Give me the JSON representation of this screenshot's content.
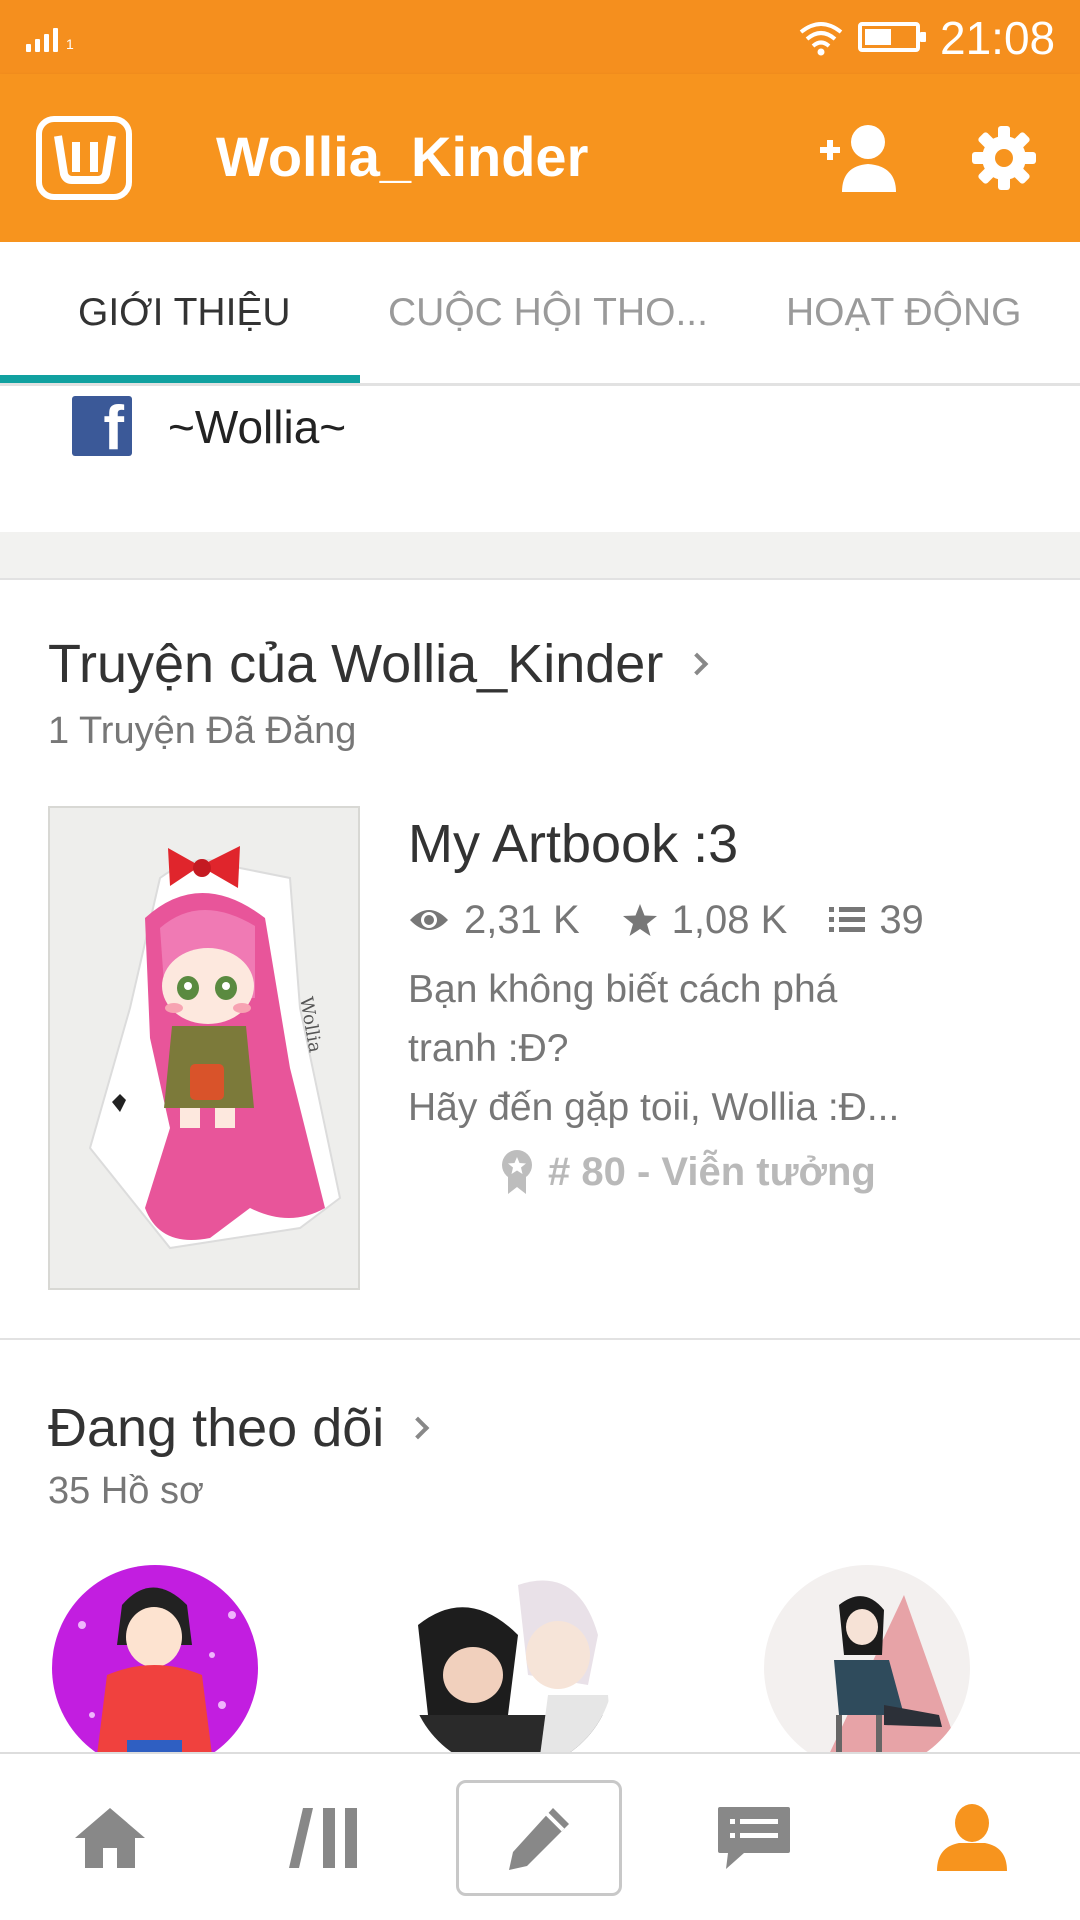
{
  "status_bar": {
    "signal_label": "1",
    "time": "21:08"
  },
  "app_bar": {
    "title": "Wollia_Kinder",
    "logo_icon": "wattpad-logo-icon",
    "actions": [
      "add-user-icon",
      "settings-icon"
    ]
  },
  "tabs": [
    {
      "label": "GIỚI THIỆU",
      "active": true
    },
    {
      "label": "CUỘC HỘI THO...",
      "active": false
    },
    {
      "label": "HOẠT ĐỘNG",
      "active": false
    }
  ],
  "facebook": {
    "icon": "facebook-icon",
    "name": "~Wollia~"
  },
  "stories": {
    "title": "Truyện của Wollia_Kinder",
    "count": "1 Truyện Đã Đăng",
    "book": {
      "title": "My Artbook :3",
      "reads": "2,31 K",
      "votes": "1,08 K",
      "parts": "39",
      "description_line1": "Bạn không biết cách phá",
      "description_line2": "tranh :Đ?",
      "description_line3": "Hãy đến gặp toii, Wollia :Đ...",
      "rank": "# 80 - Viễn tưởng"
    }
  },
  "following": {
    "title": "Đang theo dõi",
    "count": "35 Hồ sơ"
  },
  "bottom_nav": {
    "items": [
      "home-icon",
      "library-icon",
      "write-icon",
      "messages-icon",
      "profile-icon"
    ],
    "active": "profile-icon"
  },
  "colors": {
    "brand_orange": "#f7941e",
    "tab_indicator": "#11a1a0",
    "facebook_blue": "#3b5998"
  }
}
